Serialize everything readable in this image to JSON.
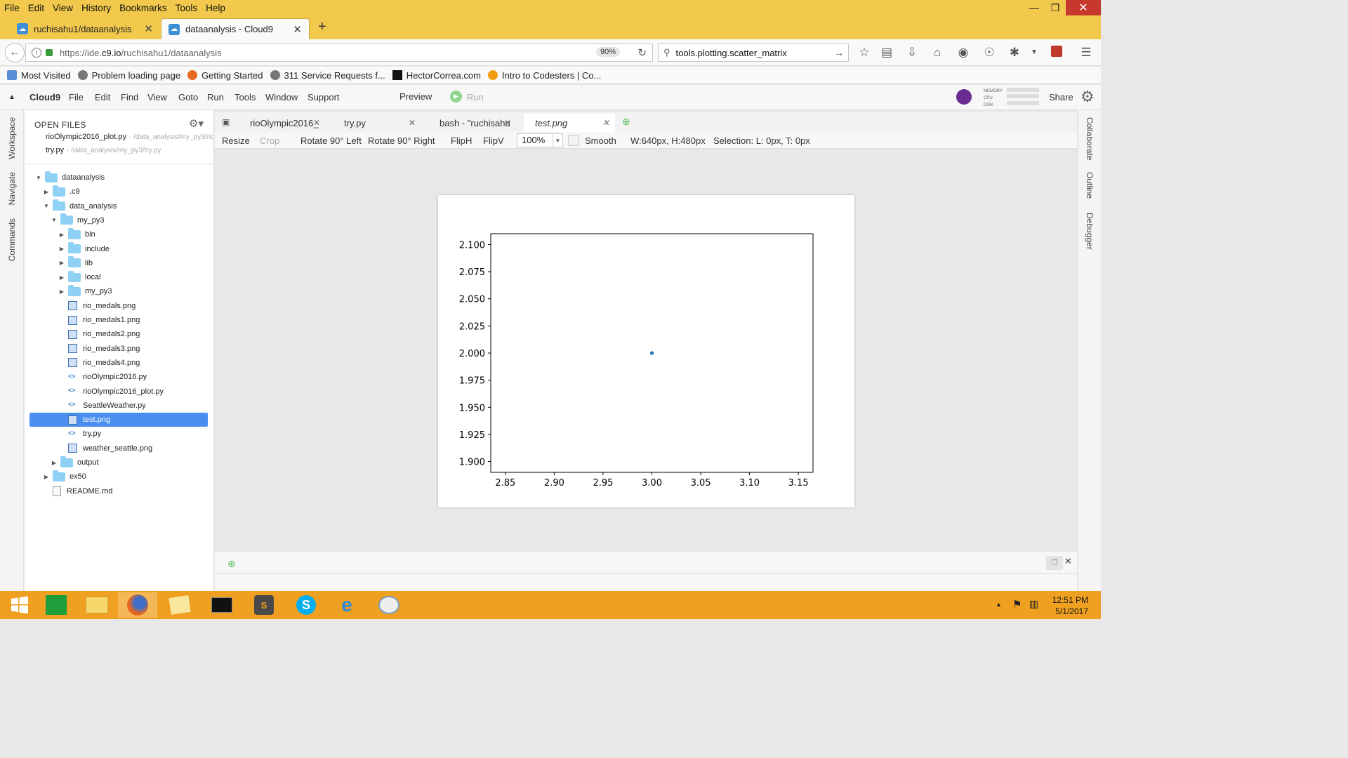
{
  "browser": {
    "menu": [
      "File",
      "Edit",
      "View",
      "History",
      "Bookmarks",
      "Tools",
      "Help"
    ],
    "tabs": [
      {
        "title": "ruchisahu1/dataanalysis",
        "active": false
      },
      {
        "title": "dataanalysis - Cloud9",
        "active": true
      }
    ],
    "url_prefix": "https://ide.",
    "url_domain": "c9.io",
    "url_suffix": "/ruchisahu1/dataanalysis",
    "zoom": "90%",
    "search_value": "tools.plotting.scatter_matrix",
    "bookmarks": [
      "Most Visited",
      "Problem loading page",
      "Getting Started",
      "311 Service Requests f...",
      "HectorCorrea.com",
      "Intro to Codesters | Co..."
    ]
  },
  "ide": {
    "brand": "Cloud9",
    "menu": [
      "File",
      "Edit",
      "Find",
      "View",
      "Goto",
      "Run",
      "Tools",
      "Window",
      "Support"
    ],
    "preview_label": "Preview",
    "run_label": "Run",
    "share_label": "Share",
    "meters": [
      "MEMORY",
      "CPU",
      "DISK"
    ],
    "left_rail": [
      "Workspace",
      "Navigate",
      "Commands"
    ],
    "right_rail": [
      "Collaborate",
      "Outline",
      "Debugger"
    ],
    "open_files_header": "OPEN FILES",
    "open_files": [
      {
        "name": "rioOlympic2016_plot.py",
        "path": "- /data_analysis/my_py3/rio"
      },
      {
        "name": "try.py",
        "path": "- /data_analysis/my_py3/try.py"
      }
    ],
    "tree": [
      {
        "label": "dataanalysis",
        "kind": "folder",
        "level": 0,
        "expanded": true
      },
      {
        "label": ".c9",
        "kind": "folder",
        "level": 1,
        "expanded": false
      },
      {
        "label": "data_analysis",
        "kind": "folder",
        "level": 1,
        "expanded": true
      },
      {
        "label": "my_py3",
        "kind": "folder",
        "level": 2,
        "expanded": true
      },
      {
        "label": "bin",
        "kind": "folder",
        "level": 3,
        "expanded": false
      },
      {
        "label": "include",
        "kind": "folder",
        "level": 3,
        "expanded": false
      },
      {
        "label": "lib",
        "kind": "folder",
        "level": 3,
        "expanded": false
      },
      {
        "label": "local",
        "kind": "folder",
        "level": 3,
        "expanded": false
      },
      {
        "label": "my_py3",
        "kind": "folder",
        "level": 3,
        "expanded": false
      },
      {
        "label": "rio_medals.png",
        "kind": "image",
        "level": 3
      },
      {
        "label": "rio_medals1.png",
        "kind": "image",
        "level": 3
      },
      {
        "label": "rio_medals2.png",
        "kind": "image",
        "level": 3
      },
      {
        "label": "rio_medals3.png",
        "kind": "image",
        "level": 3
      },
      {
        "label": "rio_medals4.png",
        "kind": "image",
        "level": 3
      },
      {
        "label": "rioOlympic2016.py",
        "kind": "python",
        "level": 3
      },
      {
        "label": "rioOlympic2016_plot.py",
        "kind": "python",
        "level": 3
      },
      {
        "label": "SeattleWeather.py",
        "kind": "python",
        "level": 3
      },
      {
        "label": "test.png",
        "kind": "image",
        "level": 3,
        "selected": true
      },
      {
        "label": "try.py",
        "kind": "python",
        "level": 3
      },
      {
        "label": "weather_seattle.png",
        "kind": "image",
        "level": 3
      },
      {
        "label": "output",
        "kind": "folder",
        "level": 2,
        "expanded": false
      },
      {
        "label": "ex50",
        "kind": "folder",
        "level": 1,
        "expanded": false
      },
      {
        "label": "README.md",
        "kind": "doc",
        "level": 1
      }
    ],
    "editor_tabs": [
      {
        "label": "rioOlympic2016_",
        "active": false
      },
      {
        "label": "try.py",
        "active": false
      },
      {
        "label": "bash - \"ruchisahu",
        "active": false
      },
      {
        "label": "test.png",
        "active": true
      }
    ],
    "image_toolbar": {
      "resize": "Resize",
      "crop": "Crop",
      "rotate_left": "Rotate 90° Left",
      "rotate_right": "Rotate 90° Right",
      "fliph": "FlipH",
      "flipv": "FlipV",
      "zoom": "100%",
      "smooth": "Smooth",
      "dimensions": "W:640px, H:480px",
      "selection": "Selection:  L: 0px, T: 0px"
    }
  },
  "chart_data": {
    "type": "scatter",
    "points": [
      {
        "x": 3.0,
        "y": 2.0
      }
    ],
    "xlim": [
      2.835,
      3.165
    ],
    "ylim": [
      1.89,
      2.11
    ],
    "xticks": [
      "2.85",
      "2.90",
      "2.95",
      "3.00",
      "3.05",
      "3.10",
      "3.15"
    ],
    "yticks": [
      "2.100",
      "2.075",
      "2.050",
      "2.025",
      "2.000",
      "1.975",
      "1.950",
      "1.925",
      "1.900"
    ],
    "point_color": "#1f77b4",
    "title": "",
    "xlabel": "",
    "ylabel": ""
  },
  "taskbar": {
    "time": "12:51 PM",
    "date": "5/1/2017",
    "apps": [
      "start",
      "store",
      "file-explorer",
      "firefox",
      "sticky-notes",
      "terminal",
      "sublime-text",
      "skype",
      "internet-explorer",
      "paint"
    ]
  }
}
